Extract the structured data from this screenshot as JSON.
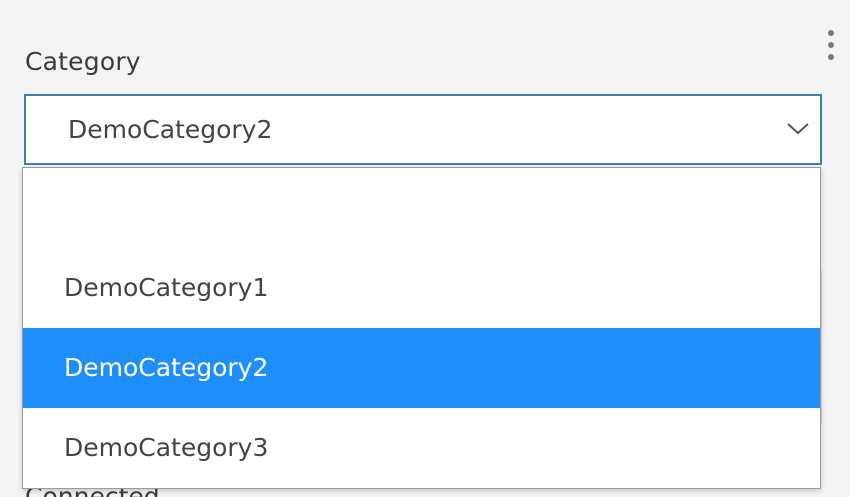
{
  "form": {
    "category_label": "Category",
    "next_label_partial": "Connected"
  },
  "select": {
    "current_value": "DemoCategory2",
    "options": [
      {
        "label": "",
        "selected": false
      },
      {
        "label": "DemoCategory1",
        "selected": false
      },
      {
        "label": "DemoCategory2",
        "selected": true
      },
      {
        "label": "DemoCategory3",
        "selected": false
      }
    ]
  },
  "icons": {
    "menu": "more-vertical-icon",
    "dropdown_arrow": "chevron-down-icon"
  },
  "colors": {
    "focus_border": "#3a83a6",
    "selected_bg": "#1e8ffa",
    "selected_text": "#ffffff",
    "text": "#444444",
    "page_bg": "#f4f4f4"
  }
}
